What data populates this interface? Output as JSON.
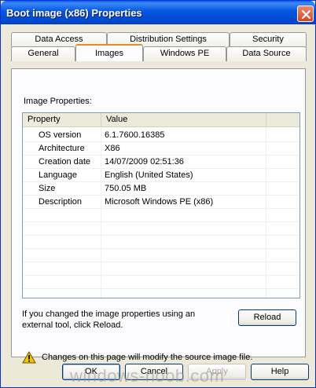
{
  "window": {
    "title": "Boot image (x86) Properties"
  },
  "tabs": {
    "row1": [
      "Data Access",
      "Distribution Settings",
      "Security"
    ],
    "row2": [
      "General",
      "Images",
      "Windows PE",
      "Data Source"
    ],
    "active": "Images"
  },
  "panel": {
    "group_label": "Image Properties:",
    "columns": [
      "Property",
      "Value"
    ],
    "rows": [
      {
        "property": "OS version",
        "value": "6.1.7600.16385"
      },
      {
        "property": "Architecture",
        "value": "X86"
      },
      {
        "property": "Creation date",
        "value": "14/07/2009 02:51:36"
      },
      {
        "property": "Language",
        "value": "English (United States)"
      },
      {
        "property": "Size",
        "value": "750.05 MB"
      },
      {
        "property": "Description",
        "value": "Microsoft Windows PE (x86)"
      }
    ],
    "info_text": "If you changed the image properties using an external tool, click Reload.",
    "reload_label": "Reload",
    "warning_text": "Changes on this page will modify the source image file."
  },
  "buttons": {
    "ok": "OK",
    "cancel": "Cancel",
    "apply": "Apply",
    "help": "Help"
  },
  "icons": {
    "close": "close-icon",
    "warning": "warning-icon"
  },
  "watermark": "windows-noob.com",
  "colors": {
    "titlebar": "#0655e0",
    "dialog_bg": "#ece9d8",
    "active_tab_accent": "#e68b2c",
    "warning": "#f5c400"
  }
}
